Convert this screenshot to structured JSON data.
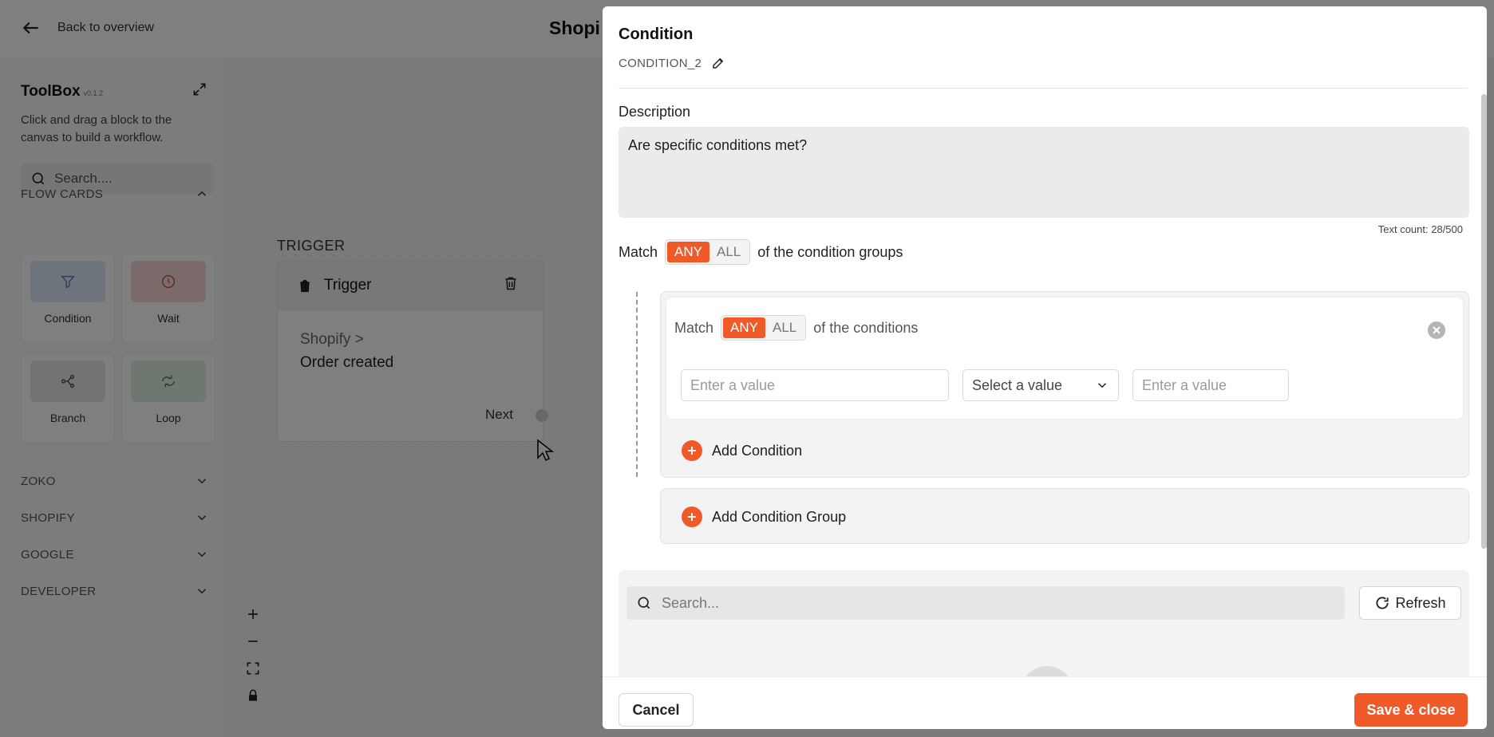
{
  "app": {
    "back_label": "Back to overview",
    "title": "Shopi"
  },
  "toolbox": {
    "title": "ToolBox",
    "version": "v0.1.2",
    "description": "Click and drag a block to the canvas to build a workflow.",
    "search_placeholder": "Search....",
    "sections": {
      "flow_cards": "FLOW CARDS",
      "zoko": "ZOKO",
      "shopify": "SHOPIFY",
      "google": "GOOGLE",
      "developer": "DEVELOPER"
    },
    "cards": [
      {
        "label": "Condition",
        "icon": "filter-icon",
        "color": "#dbe8f7"
      },
      {
        "label": "Wait",
        "icon": "clock-icon",
        "color": "#f6d9d6"
      },
      {
        "label": "Branch",
        "icon": "branch-icon",
        "color": "#e6e6e6"
      },
      {
        "label": "Loop",
        "icon": "loop-icon",
        "color": "#dcefe1"
      }
    ]
  },
  "canvas": {
    "trigger_label": "TRIGGER",
    "trigger_title": "Trigger",
    "trigger_source": "Shopify >",
    "trigger_event": "Order created",
    "next_label": "Next"
  },
  "modal": {
    "title": "Condition",
    "id": "CONDITION_2",
    "description_label": "Description",
    "description_value": "Are specific conditions met?",
    "text_count": "Text count: 28/500",
    "match_prefix": "Match",
    "any_label": "ANY",
    "all_label": "ALL",
    "groups_suffix": "of the condition groups",
    "conditions_suffix": "of the conditions",
    "field1_placeholder": "Enter a value",
    "select_placeholder": "Select a value",
    "field2_placeholder": "Enter a value",
    "add_condition": "Add Condition",
    "add_condition_group": "Add Condition Group",
    "search_placeholder": "Search...",
    "refresh_label": "Refresh",
    "cancel_label": "Cancel",
    "save_label": "Save & close"
  },
  "colors": {
    "accent": "#f05a28"
  }
}
